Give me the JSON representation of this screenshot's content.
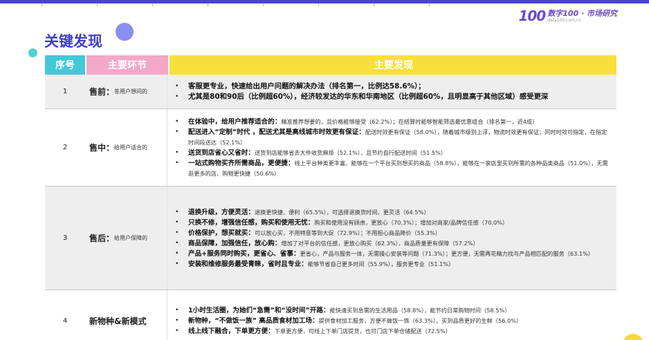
{
  "logo": {
    "number": "100",
    "name": "数字100 · 市场研究",
    "url": "data100.com.cn"
  },
  "title": "关键发现",
  "header": {
    "no": "序号",
    "stage": "主要环节",
    "findings": "主要发现"
  },
  "rows": [
    {
      "no": "1",
      "stage": "售前：",
      "stage_sub": "答用户想问的",
      "items": [
        {
          "bold": "客服更专业，快速给出用户问题的解决办法（排名第一，比例达58.6%）；",
          "text": ""
        },
        {
          "bold": "尤其是80和90后（比例超60%），经济较发达的华东和华南地区（比例超60%，且明显高于其他区域）感受更深",
          "text": ""
        }
      ]
    },
    {
      "no": "2",
      "stage": "售中：",
      "stage_sub": "给用户适合的",
      "items": [
        {
          "bold": "在体验中，给用户推荐适合的：",
          "text": "精准推荐想要的，且价格能够接受（62.2%）；在结算时能够智能筛选最优惠组合（排名第一，近4成）"
        },
        {
          "bold": "配送进入“定制”时代 ，配送尤其是高线城市时效更有保证：",
          "text": "配送时效更有保证（58.0%），随着城市级别上浮，物流时效更有保证；同时时效可指定，在指定时间段送达（52.1%）"
        },
        {
          "bold": "送货到店省心又省时：",
          "text": "送货到店能够省去大件收货麻烦（52.1%），且节约自行配送时间（51.5%）"
        },
        {
          "bold": "一站式购物买齐所需商品，更便捷：",
          "text": "线上平台种类更丰富、能够在一个平台买到想买的商品（58.8%），能够在一家店里买到所需的各种品类商品（51.0%），无需逛更多的店、购物更快捷（50.6%）"
        }
      ]
    },
    {
      "no": "3",
      "stage": "售后：",
      "stage_sub": "给用户保障的",
      "items": [
        {
          "bold": "退换升级，方便灵活：",
          "text": "退换更快捷、便利（65.5%），可选择退换货时间，更灵活（64.5%）"
        },
        {
          "bold": "只换不修，增强信任感，购买和使用无忧：",
          "text": "购买和使用没有顾虑，更放心（70.3%）；增加对商家/品牌信任感（70.0%）"
        },
        {
          "bold": "价格保护，想买就买：",
          "text": "可以放心买，不用特意等到大促（72.9%）；不用担心商品降价（55.3%）"
        },
        {
          "bold": "商品保障，加强信任，放心购：",
          "text": "增加了对平台的信任感，更放心购买（62.3%），商品质量更有保障（57.2%）"
        },
        {
          "bold": "产品+服务同时购买，更省心、省事：",
          "text": "更省心，产品与服务一体，无需操心安装等问题（71.3%）；更方便，无需再花精力找与产品相匹配的服务（63.1%）"
        },
        {
          "bold": "安装和维修服务最受青睐，省时且专业：",
          "text": "能够节省自己更多时间（55.9%），服务更专业（51.1%）"
        }
      ]
    },
    {
      "no": "4",
      "stage": "新物种&新模式",
      "stage_sub": "",
      "items": [
        {
          "bold": "1小时生活圈，为她们“急需”和“没时间”开路：",
          "text": "能快速买到急需的生活用品（58.8%），能节约日常购物时间（58.5%）"
        },
        {
          "bold": "新物种，“不做饭一族” 高品质食材加工场：",
          "text": "提供食材加工服务，方便不做饭一族（63.3%），买到品质更好的生鲜（56.0%）"
        },
        {
          "bold": "线上线下融合，下单更方便：",
          "text": "下单更方便，可线上下单门店提货，也可门店下单仓储配送（72.5%）"
        }
      ]
    }
  ]
}
